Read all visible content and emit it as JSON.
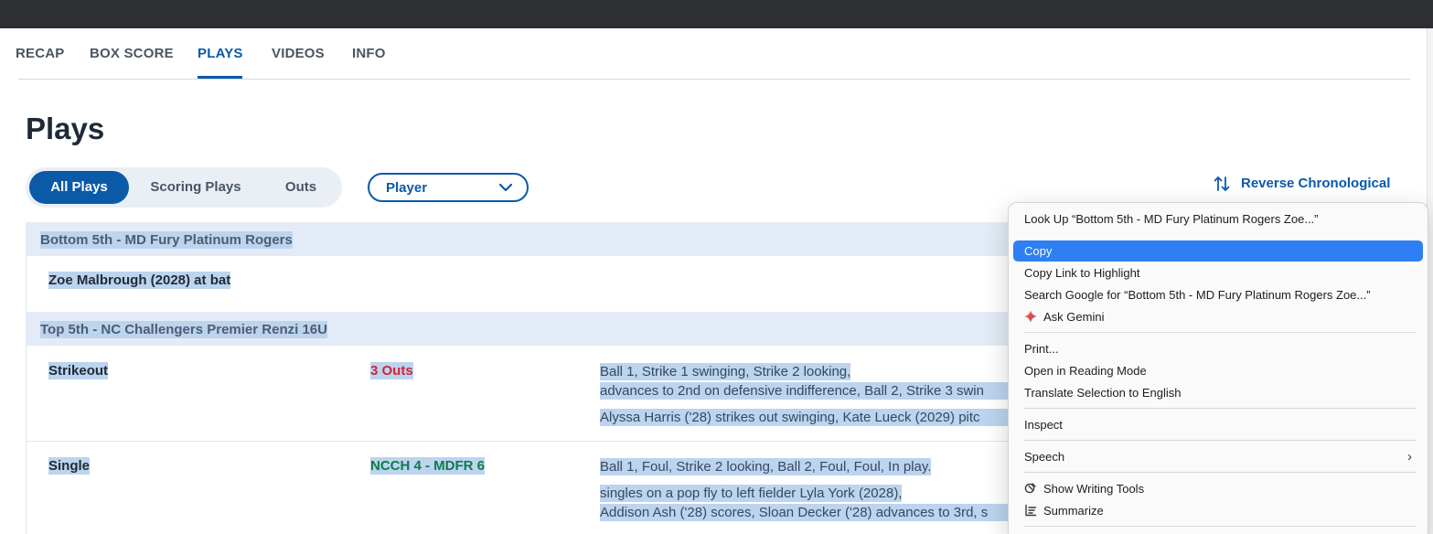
{
  "tabs": [
    "RECAP",
    "BOX SCORE",
    "PLAYS",
    "VIDEOS",
    "INFO"
  ],
  "active_tab": "PLAYS",
  "page_title": "Plays",
  "filters": [
    "All Plays",
    "Scoring Plays",
    "Outs"
  ],
  "active_filter": "All Plays",
  "player_select": {
    "value": "Player",
    "icon": "chevron-down-icon"
  },
  "sort": {
    "label": "Reverse Chronological",
    "icon": "sort-arrows-icon"
  },
  "accent_color": "#0a5aa8",
  "plays": {
    "bottom5_header": "Bottom 5th - MD Fury Platinum Rogers",
    "bottom5_atbat": "Zoe Malbrough (2028) at bat",
    "top5_header": "Top 5th - NC Challengers Premier Renzi 16U",
    "strikeout": {
      "type": "Strikeout",
      "status": "3 Outs",
      "line1": "Ball 1, Strike 1 swinging, Strike 2 looking,",
      "line2": "advances to 2nd on defensive indifference, Ball 2, Strike 3 swin",
      "line3": "Alyssa Harris ('28) strikes out swinging, Kate Lueck (2029) pitc"
    },
    "single": {
      "type": "Single",
      "status": "NCCH 4 - MDFR 6",
      "line1": "Ball 1, Foul, Strike 2 looking, Ball 2, Foul, Foul, In play.",
      "line2": "singles on a pop fly to left fielder Lyla York (2028),",
      "line3": "Addison Ash ('28) scores, Sloan Decker ('28) advances to 3rd, s"
    }
  },
  "context_menu": {
    "look_up": "Look Up “Bottom 5th - MD Fury Platinum Rogers Zoe...”",
    "copy": "Copy",
    "copy_link": "Copy Link to Highlight",
    "search_google": "Search Google for “Bottom 5th - MD Fury Platinum Rogers Zoe...”",
    "ask_gemini": "Ask Gemini",
    "print": "Print...",
    "reading_mode": "Open in Reading Mode",
    "translate": "Translate Selection to English",
    "inspect": "Inspect",
    "speech": "Speech",
    "writing_tools": "Show Writing Tools",
    "summarize": "Summarize",
    "highlight_color": "#2d7ff3"
  }
}
